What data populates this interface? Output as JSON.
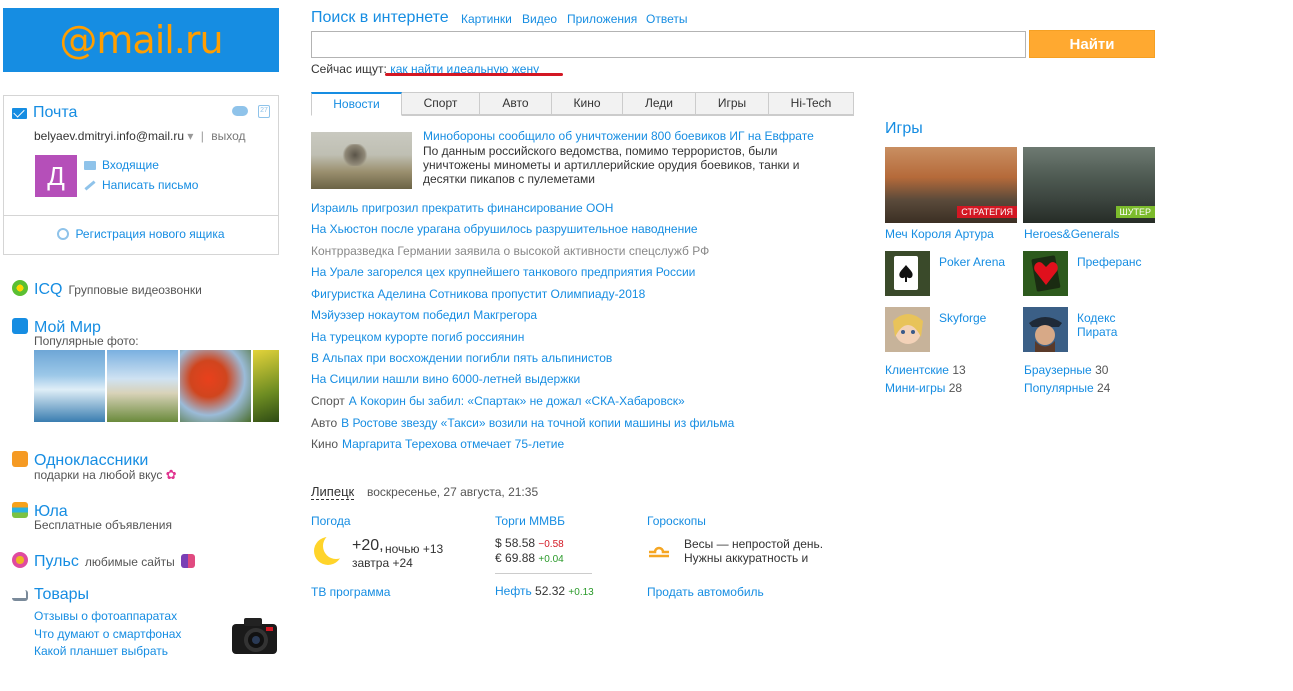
{
  "logo": {
    "text": "@mail.ru"
  },
  "mail": {
    "title": "Почта",
    "email": "belyaev.dmitryi.info@mail.ru",
    "arrow": "▾",
    "sep": "|",
    "exit": "выход",
    "avatar_letter": "Д",
    "inbox": "Входящие",
    "write": "Написать письмо",
    "register": "Регистрация нового ящика",
    "calendar_num": "27"
  },
  "services": {
    "icq": {
      "name": "ICQ",
      "desc": "Групповые видеозвонки"
    },
    "myworld": {
      "name": "Мой Мир",
      "desc": "Популярные фото:"
    },
    "ok": {
      "name": "Одноклассники",
      "desc": "подарки на любой вкус"
    },
    "yula": {
      "name": "Юла",
      "desc": "Бесплатные объявления"
    },
    "pulse": {
      "name": "Пульс",
      "desc": "любимые сайты"
    },
    "goods": {
      "name": "Товары",
      "links": [
        "Отзывы о фотоаппаратах",
        "Что думают о смартфонах",
        "Какой планшет выбрать"
      ]
    }
  },
  "search": {
    "title": "Поиск в интернете",
    "links": [
      "Картинки",
      "Видео",
      "Приложения",
      "Ответы"
    ],
    "input_value": "",
    "button": "Найти",
    "now_label": "Сейчас ищут:",
    "now_query": "как найти идеальную жену"
  },
  "tabs": [
    {
      "label": "Новости",
      "active": true
    },
    {
      "label": "Спорт"
    },
    {
      "label": "Авто"
    },
    {
      "label": "Кино"
    },
    {
      "label": "Леди"
    },
    {
      "label": "Игры"
    },
    {
      "label": "Hi-Tech"
    }
  ],
  "top_news": {
    "title": "Минобороны сообщило об уничтожении 800 боевиков ИГ на Евфрате",
    "text": "По данным российского ведомства, помимо террористов, были уничтожены минометы и артиллерийские орудия боевиков, танки и десятки пикапов с пулеметами"
  },
  "news": [
    {
      "text": "Израиль пригрозил прекратить финансирование ООН"
    },
    {
      "text": "На Хьюстон после урагана обрушилось разрушительное наводнение"
    },
    {
      "text": "Контрразведка Германии заявила о высокой активности спецслужб РФ",
      "visited": true
    },
    {
      "text": "На Урале загорелся цех крупнейшего танкового предприятия России"
    },
    {
      "text": "Фигуристка Аделина Сотникова пропустит Олимпиаду-2018"
    },
    {
      "text": "Мэйуэзер нокаутом победил Макгрегора"
    },
    {
      "text": "На турецком курорте погиб россиянин"
    },
    {
      "text": "В Альпах при восхождении погибли пять альпинистов"
    },
    {
      "text": "На Сицилии нашли вино 6000-летней выдержки"
    },
    {
      "cat": "Спорт",
      "text": "А Кокорин бы забил: «Спартак» не дожал «СКА-Хабаровск»"
    },
    {
      "cat": "Авто",
      "text": "В Ростове звезду «Такси» возили на точной копии машины из фильма"
    },
    {
      "cat": "Кино",
      "text": "Маргарита Терехова отмечает 75-летие"
    }
  ],
  "info": {
    "city": "Липецк",
    "date": "воскресенье, 27 августа, 21:35",
    "weather_title": "Погода",
    "temp": "+20,",
    "night": "ночью +13",
    "tomorrow": "завтра +24",
    "fx_title": "Торги ММВБ",
    "usd_sym": "$",
    "usd": "58.58",
    "usd_ch": "−0.58",
    "eur_sym": "€",
    "eur": "69.88",
    "eur_ch": "+0.04",
    "horo_title": "Гороскопы",
    "horo_line1": "Весы — непростой день.",
    "horo_line2": "Нужны аккуратность и",
    "tv": "ТВ программа",
    "oil_label": "Нефть",
    "oil": "52.32",
    "oil_ch": "+0.13",
    "auto": "Продать автомобиль"
  },
  "games": {
    "title": "Игры",
    "featured": [
      {
        "name": "Меч Короля Артура",
        "tag": "СТРАТЕГИЯ",
        "tag_color": "#d31723"
      },
      {
        "name": "Heroes&Generals",
        "tag": "ШУТЕР",
        "tag_color": "#7cbb2c"
      }
    ],
    "cards": [
      {
        "name": "Poker Arena"
      },
      {
        "name": "Преферанс"
      },
      {
        "name": "Skyforge"
      },
      {
        "name1": "Кодекс",
        "name2": "Пирата"
      }
    ],
    "counts": [
      {
        "label": "Клиентские",
        "n": "13"
      },
      {
        "label": "Браузерные",
        "n": "30"
      },
      {
        "label": "Мини-игры",
        "n": "28"
      },
      {
        "label": "Популярные",
        "n": "24"
      }
    ]
  }
}
